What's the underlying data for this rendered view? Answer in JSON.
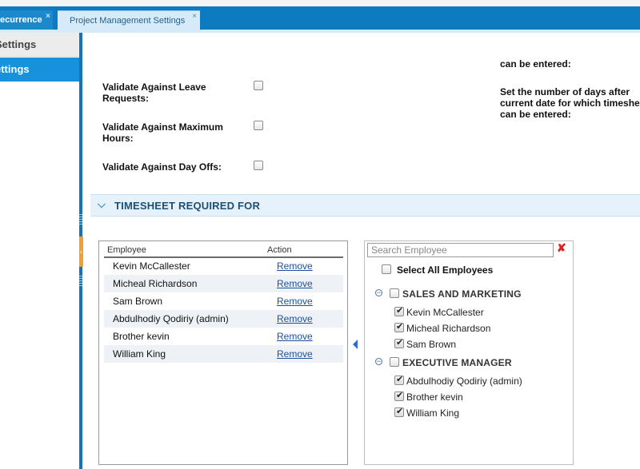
{
  "tabs": [
    {
      "label": "ecurrence",
      "close": "×"
    },
    {
      "label": "Project Management Settings",
      "close": "×"
    }
  ],
  "sidebar": {
    "items": [
      {
        "label": "Settings",
        "active": false
      },
      {
        "label": "ettings",
        "active": true
      }
    ]
  },
  "settings": {
    "rows": [
      {
        "label": "Validate Against Leave Requests:",
        "checked": false
      },
      {
        "label": "Validate Against Maximum Hours:",
        "checked": false
      },
      {
        "label": "Validate Against Day Offs:",
        "checked": false
      }
    ],
    "note_top": "can be entered:",
    "note_lines": [
      "Set the number of days after",
      "current date for which timeshee",
      "can be entered:"
    ]
  },
  "section": {
    "title": "TIMESHEET REQUIRED FOR"
  },
  "employee_table": {
    "columns": [
      "Employee",
      "Action"
    ],
    "rows": [
      {
        "name": "Kevin McCallester",
        "action": "Remove"
      },
      {
        "name": "Micheal Richardson",
        "action": "Remove"
      },
      {
        "name": "Sam Brown",
        "action": "Remove"
      },
      {
        "name": "Abdulhodiy Qodiriy (admin)",
        "action": "Remove"
      },
      {
        "name": "Brother kevin",
        "action": "Remove"
      },
      {
        "name": "William King",
        "action": "Remove"
      }
    ]
  },
  "tree": {
    "search_placeholder": "Search Employee",
    "select_all_label": "Select All Employees",
    "groups": [
      {
        "name": "SALES AND MARKETING",
        "members": [
          "Kevin McCallester",
          "Micheal Richardson",
          "Sam Brown"
        ]
      },
      {
        "name": "EXECUTIVE MANAGER",
        "members": [
          "Abdulhodiy Qodiriy (admin)",
          "Brother kevin",
          "William King"
        ]
      }
    ]
  },
  "colors": {
    "accent": "#0e7bc1",
    "active_sidebar": "#1592db",
    "section_bg": "#e6f2fb",
    "link": "#1c4f9c"
  }
}
